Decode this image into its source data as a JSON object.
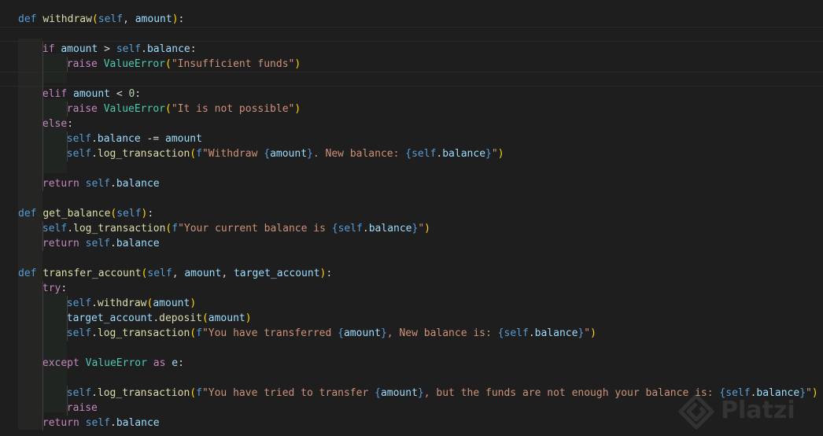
{
  "editor": {
    "language": "python",
    "theme_colors": {
      "background": "#1e1e1e",
      "keyword": "#569cd6",
      "control": "#c586c0",
      "function": "#dcdcaa",
      "variable": "#9cdcfe",
      "class": "#4ec9b0",
      "string": "#ce9178",
      "number": "#b5cea8"
    },
    "lines": [
      "def withdraw(self, amount):",
      "",
      "    if amount > self.balance:",
      "        raise ValueError(\"Insufficient funds\")",
      "",
      "    elif amount < 0:",
      "        raise ValueError(\"It is not possible\")",
      "    else:",
      "        self.balance -= amount",
      "        self.log_transaction(f\"Withdraw {amount}. New balance: {self.balance}\")",
      "",
      "    return self.balance",
      "",
      "def get_balance(self):",
      "    self.log_transaction(f\"Your current balance is {self.balance}\")",
      "    return self.balance",
      "",
      "def transfer_account(self, amount, target_account):",
      "    try:",
      "        self.withdraw(amount)",
      "        target_account.deposit(amount)",
      "        self.log_transaction(f\"You have transferred {amount}, New balance is: {self.balance}\")",
      "",
      "    except ValueError as e:",
      "",
      "        self.log_transaction(f\"You have tried to transfer {amount}, but the funds are not enough your balance is: {self.balance}\")",
      "        raise",
      "    return self.balance"
    ]
  },
  "watermark": {
    "brand": "Platzi",
    "icon": "platzi-logo-icon"
  }
}
